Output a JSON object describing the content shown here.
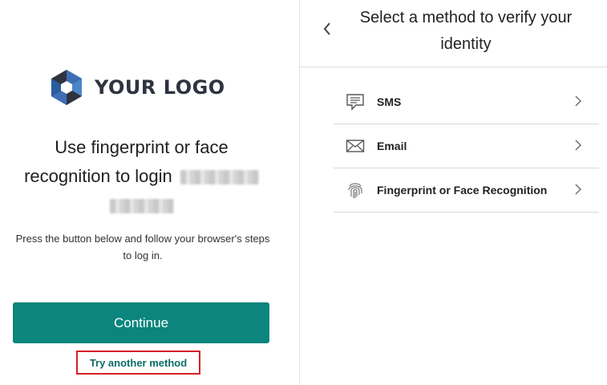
{
  "left": {
    "logo_text": "YOUR LOGO",
    "headline_line1": "Use fingerprint or face",
    "headline_line2": "recognition to login",
    "subtext": "Press the button below and follow your browser's steps to log in.",
    "continue_label": "Continue",
    "try_another_label": "Try another method"
  },
  "right": {
    "title": "Select a method to verify your identity",
    "methods": [
      {
        "label": "SMS",
        "icon": "sms-icon"
      },
      {
        "label": "Email",
        "icon": "envelope-icon"
      },
      {
        "label": "Fingerprint or Face Recognition",
        "icon": "fingerprint-icon"
      }
    ]
  },
  "colors": {
    "accent": "#0b857d",
    "link": "#0b6d66",
    "highlight_border": "#d61f26",
    "logo_dark": "#2f3340",
    "logo_blue": "#3d6fb6"
  }
}
